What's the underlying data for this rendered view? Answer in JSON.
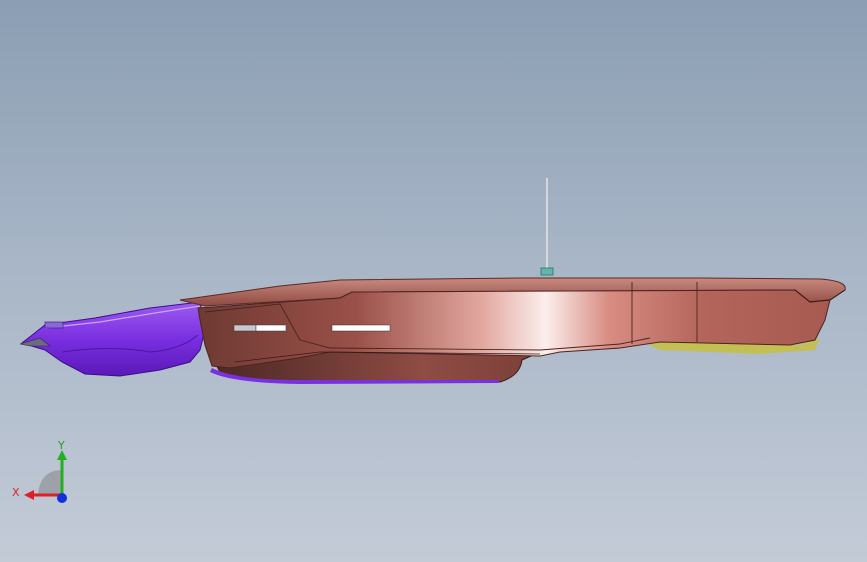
{
  "viewport": {
    "background_top": "#8b9eb3",
    "background_bottom": "#c3cbd7"
  },
  "model": {
    "body_color": "#b56a60",
    "body_highlight": "#f6e4e2",
    "front_section_color": "#7a2fe0",
    "underside_accent": "#c8c040"
  },
  "triad": {
    "x_label": "X",
    "y_label": "Y",
    "x_color": "#e02020",
    "y_color": "#20b020",
    "z_color": "#1030e0"
  }
}
